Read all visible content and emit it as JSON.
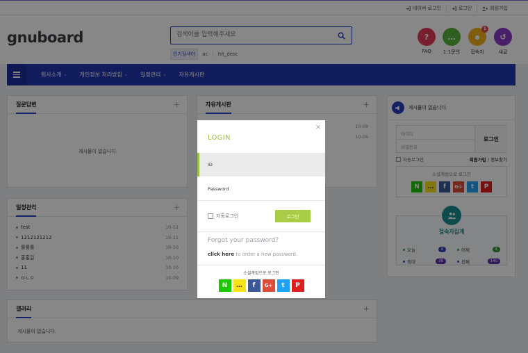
{
  "toplinks": {
    "naver_login": "네이버 로그인",
    "login": "로그인",
    "register": "회원가입"
  },
  "logo": {
    "text": "gnuboard"
  },
  "search": {
    "placeholder": "검색어를 입력해주세요",
    "popular_label": "인기검색어",
    "popular_terms": [
      "ac",
      "hit_desc"
    ]
  },
  "quick": [
    {
      "label": "FAQ",
      "glyph": "?",
      "color": "#e03b57"
    },
    {
      "label": "1:1문의",
      "glyph": "…",
      "color": "#5ab33d"
    },
    {
      "label": "접속자",
      "glyph": "●",
      "color": "#f2b01e",
      "badge": "1"
    },
    {
      "label": "새글",
      "glyph": "↺",
      "color": "#8b3cc9"
    }
  ],
  "nav": {
    "items": [
      "회사소개",
      "개인정보 처리방침",
      "일정관리",
      "자유게시판"
    ]
  },
  "panels": {
    "qna": {
      "title": "질문답변",
      "empty": "게시물이 없습니다."
    },
    "free": {
      "title": "자유게시판",
      "dates": [
        "10-08",
        "10-06"
      ]
    },
    "schedule": {
      "title": "일정관리",
      "rows": [
        {
          "title": "test",
          "date": "10-12"
        },
        {
          "title": "1212121212",
          "date": "10-11"
        },
        {
          "title": "룰룰룰",
          "date": "10-10"
        },
        {
          "title": "홍홍길",
          "date": "10-10"
        },
        {
          "title": "11",
          "date": "10-10"
        },
        {
          "title": "ㅁㄴㅇ",
          "date": "10-09"
        }
      ]
    },
    "gallery": {
      "title": "갤러리",
      "empty": "게시물이 없습니다."
    }
  },
  "sidebar": {
    "notice": "게시물이 없습니다.",
    "id_placeholder": "아이디",
    "pw_placeholder": "비밀번호",
    "login_button": "로그인",
    "auto_login": "자동로그인",
    "register": "회원가입",
    "slash": "/",
    "find": "정보찾기",
    "social_title": "소셜계정으로 로그인",
    "visitor_title": "접속자집계",
    "visitors": [
      {
        "label": "오늘",
        "value": "4",
        "color": "#3a47b8",
        "dot": "#3a9a3a"
      },
      {
        "label": "어제",
        "value": "4",
        "color": "#3a9a3a",
        "dot": "#3a9a3a"
      },
      {
        "label": "최대",
        "value": "39",
        "color": "#5b2fa8",
        "dot": "#3a47b8"
      },
      {
        "label": "전체",
        "value": "140",
        "color": "#5b2fa8",
        "dot": "#3a47b8"
      }
    ]
  },
  "social_icons": [
    {
      "name": "naver",
      "glyph": "N",
      "color": "#1ec800"
    },
    {
      "name": "kakao",
      "glyph": "…",
      "color": "#f7e317"
    },
    {
      "name": "facebook",
      "glyph": "f",
      "color": "#3b5998"
    },
    {
      "name": "google",
      "glyph": "G+",
      "color": "#dd4b39"
    },
    {
      "name": "twitter",
      "glyph": "t",
      "color": "#1da1f2"
    },
    {
      "name": "payco",
      "glyph": "P",
      "color": "#e02020"
    }
  ],
  "modal": {
    "title": "LOGIN",
    "id_label": "ID",
    "password_label": "Password",
    "auto_login": "자동로그인",
    "login_button": "로그인",
    "forgot": "Forgot your password?",
    "click_here": "click here",
    "order_text": " to order a new password.",
    "social_title": "소셜계정으로 로그인",
    "close": "×"
  }
}
